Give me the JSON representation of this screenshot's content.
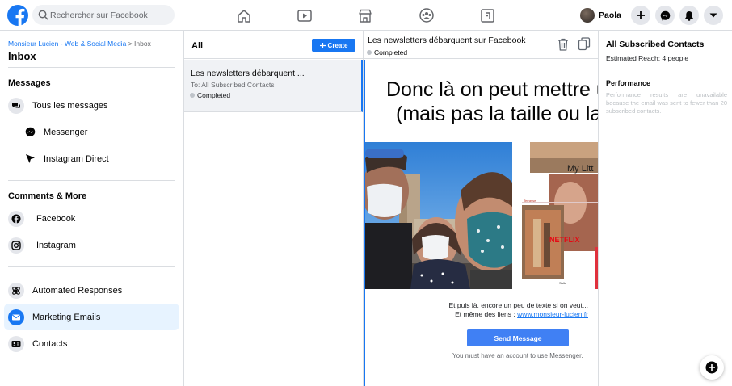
{
  "header": {
    "search_placeholder": "Rechercher sur Facebook",
    "user_name": "Paola",
    "brand_color": "#1877f2",
    "nav_icons": [
      "home-icon",
      "watch-icon",
      "marketplace-icon",
      "groups-icon",
      "gaming-icon"
    ],
    "action_icons": [
      "plus-icon",
      "messenger-icon",
      "notifications-icon",
      "caret-down-icon"
    ]
  },
  "sidebar": {
    "breadcrumb_page": "Monsieur Lucien - Web & Social Media",
    "breadcrumb_sep": ">",
    "breadcrumb_current": "Inbox",
    "title": "Inbox",
    "messages_section": "Messages",
    "items": [
      {
        "label": "Tous les messages",
        "icon": "chat-bubbles-icon"
      },
      {
        "label": "Messenger",
        "icon": "messenger-icon"
      },
      {
        "label": "Instagram Direct",
        "icon": "direct-send-icon"
      }
    ],
    "comments_section": "Comments & More",
    "comment_items": [
      {
        "label": "Facebook",
        "icon": "facebook-icon"
      },
      {
        "label": "Instagram",
        "icon": "instagram-icon"
      }
    ],
    "tools": [
      {
        "label": "Automated Responses",
        "icon": "automation-icon"
      },
      {
        "label": "Marketing Emails",
        "icon": "email-icon",
        "active": true
      },
      {
        "label": "Contacts",
        "icon": "contacts-icon"
      }
    ]
  },
  "list": {
    "filter": "All",
    "create_label": "Create",
    "rows": [
      {
        "title": "Les newsletters débarquent ...",
        "to": "To: All Subscribed Contacts",
        "status": "Completed"
      }
    ]
  },
  "preview": {
    "title": "Les newsletters débarquent sur Facebook",
    "status": "Completed",
    "big_line1": "Donc là on peut mettre un",
    "big_line2": "(mais pas la taille ou la t",
    "body_line1": "Et puis là, encore un peu de texte si on veut...",
    "body_line2_prefix": "Et même des liens :",
    "body_link": "www.monsieur-lucien.fr",
    "send_button": "Send Message",
    "note": "You must have an account to use Messenger.",
    "image_text_1": "My Litt",
    "image_text_2": "NETFLIX",
    "image_text_3": "Terrasse",
    "image_text_4": "Salle"
  },
  "details": {
    "title": "All Subscribed Contacts",
    "reach": "Estimated Reach: 4 people",
    "perf_title": "Performance",
    "perf_note": "Performance results are unavailable because the email was sent to fewer than 20 subscribed contacts."
  }
}
